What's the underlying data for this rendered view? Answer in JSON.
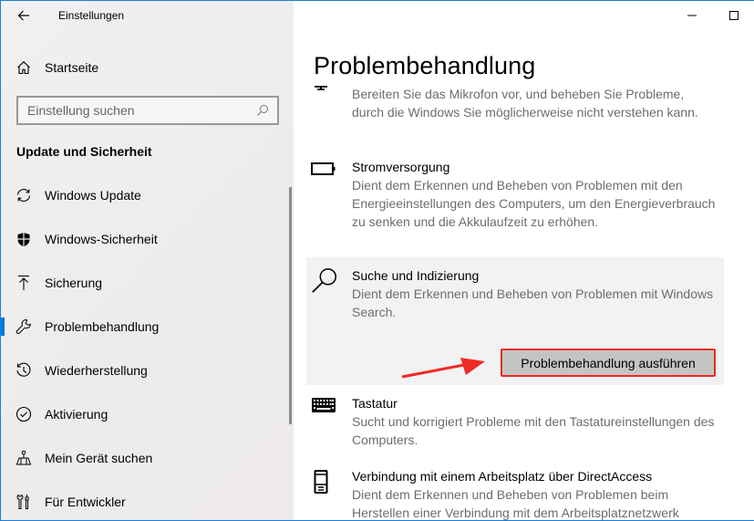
{
  "window": {
    "app_title": "Einstellungen",
    "accent_color": "#0078d7",
    "controls": {
      "minimize": "minimize-icon",
      "maximize": "maximize-icon"
    }
  },
  "sidebar": {
    "back_icon": "back-arrow-icon",
    "home": {
      "label": "Startseite",
      "icon": "home-icon"
    },
    "search": {
      "placeholder": "Einstellung suchen",
      "value": "",
      "icon": "search-icon"
    },
    "section_title": "Update und Sicherheit",
    "items": [
      {
        "label": "Windows Update",
        "icon": "refresh-icon",
        "active": false
      },
      {
        "label": "Windows-Sicherheit",
        "icon": "shield-icon",
        "active": false
      },
      {
        "label": "Sicherung",
        "icon": "backup-upload-icon",
        "active": false
      },
      {
        "label": "Problembehandlung",
        "icon": "wrench-icon",
        "active": true
      },
      {
        "label": "Wiederherstellung",
        "icon": "history-icon",
        "active": false
      },
      {
        "label": "Aktivierung",
        "icon": "check-circle-icon",
        "active": false
      },
      {
        "label": "Mein Gerät suchen",
        "icon": "find-device-icon",
        "active": false
      },
      {
        "label": "Für Entwickler",
        "icon": "developer-tools-icon",
        "active": false
      }
    ]
  },
  "main": {
    "page_title": "Problembehandlung",
    "troubleshooters": [
      {
        "name": "",
        "icon": "microphone-icon",
        "description": "Bereiten Sie das Mikrofon vor, und beheben Sie Probleme, durch die Windows Sie möglicherweise nicht verstehen kann."
      },
      {
        "name": "Stromversorgung",
        "icon": "battery-icon",
        "description": "Dient dem Erkennen und Beheben von Problemen mit den Energieeinstellungen des Computers, um den Energieverbrauch zu senken und die Akkulaufzeit zu erhöhen."
      },
      {
        "name": "Suche und Indizierung",
        "icon": "search-magnifier-icon",
        "description": "Dient dem Erkennen und Beheben von Problemen mit Windows Search.",
        "expanded": true,
        "action_label": "Problembehandlung ausführen"
      },
      {
        "name": "Tastatur",
        "icon": "keyboard-icon",
        "description": "Sucht und korrigiert Probleme mit den Tastatureinstellungen des Computers."
      },
      {
        "name": "Verbindung mit einem Arbeitsplatz über DirectAccess",
        "icon": "phone-device-icon",
        "description": "Dient dem Erkennen und Beheben von Problemen beim Herstellen einer Verbindung mit dem Arbeitsplatznetzwerk"
      }
    ]
  },
  "annotation": {
    "arrow_color": "#ef2a26",
    "highlight_color": "#ef2a26"
  }
}
